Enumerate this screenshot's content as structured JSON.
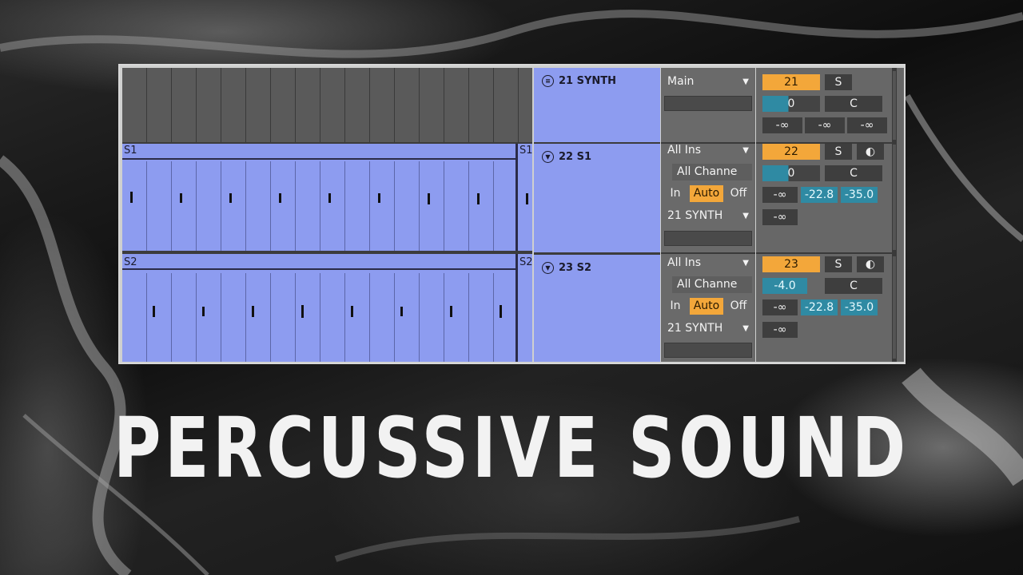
{
  "title_text": "PERCUSSIVE SOUND",
  "colors": {
    "clip": "#8d9cf0",
    "orange": "#f3a73a",
    "teal": "#2f8aa3",
    "panel": "#676767"
  },
  "arrangement": {
    "clips": [
      {
        "name": "S1",
        "name_right": "S1"
      },
      {
        "name": "S2",
        "name_right": "S2"
      }
    ]
  },
  "tracks": [
    {
      "number_name": "21 SYNTH",
      "icon": "group-fold-icon",
      "output": "Main",
      "track_number": "21",
      "solo": "S",
      "volume": "0",
      "pan": "C",
      "meters": [
        "-∞",
        "-∞",
        "-∞"
      ]
    },
    {
      "number_name": "22 S1",
      "icon": "chevron-down-icon",
      "input_type": "All Ins",
      "input_channel": "All Channe",
      "monitor": [
        "In",
        "Auto",
        "Off"
      ],
      "output": "21 SYNTH",
      "track_number": "22",
      "solo": "S",
      "volume": "0",
      "pan": "C",
      "meters": [
        "-∞",
        "-22.8",
        "-35.0"
      ],
      "send": "-∞"
    },
    {
      "number_name": "23 S2",
      "icon": "chevron-down-icon",
      "input_type": "All Ins",
      "input_channel": "All Channe",
      "monitor": [
        "In",
        "Auto",
        "Off"
      ],
      "output": "21 SYNTH",
      "track_number": "23",
      "solo": "S",
      "volume": "-4.0",
      "pan": "C",
      "meters": [
        "-∞",
        "-22.8",
        "-35.0"
      ],
      "send": "-∞"
    }
  ]
}
